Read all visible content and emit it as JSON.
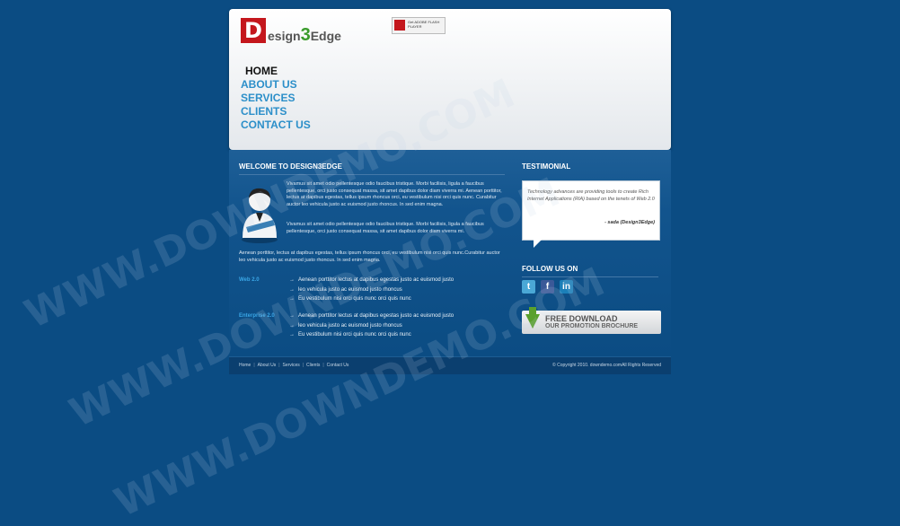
{
  "header": {
    "logo_mark": "D",
    "logo_word_a": "esign",
    "logo_num": "3",
    "logo_word_b": "Edge",
    "flash_badge": "Get ADOBE FLASH PLAYER"
  },
  "nav": [
    "HOME",
    "ABOUT US",
    "SERVICES",
    "CLIENTS",
    "CONTACT US"
  ],
  "main": {
    "heading": "WELCOME TO DESIGN3EDGE",
    "para1": "Vivamus sit amet odio pellentesque odio faucibus tristique. Morbi facilisis, ligula a faucibus pellentesque, orci justo consequat massa, sit amet dapibus dolor diam viverra mi. Aenean porttitor, lectus at dapibus egestas, tellus ipsum rhoncus orci, eu vestibulum nisi orci quis nunc. Curabitur auctor leo vehicula justo ac euismod justo rhoncus. In sed enim magna.",
    "para2": "Vivamus sit amet odio pellentesque odio faucibus tristique. Morbi facilisis, ligula a faucibus pellentesque, orci justo consequat massa, sit amet dapibus dolor diam viverra mi.",
    "para3": "Aenean porttitor, lectus at dapibus egestas, tellus ipsum rhoncus orci, eu vestibulum nisi orci quis nunc.Curabitur auctor leo vehicula justo ac euismod justo rhoncus. In sed enim magna.",
    "features": [
      {
        "label": "Web 2.0",
        "items": [
          "Aenean porttitor lectus at dapibus egestas justo ac euismod justo",
          "leo vehicula justo ac euismod justo rhoncus",
          "Eu vestibulum nisi orci quis nunc orci quis nunc"
        ]
      },
      {
        "label": "Enterprise 2.0",
        "items": [
          "Aenean porttitor lectus at dapibus egestas justo ac euismod justo",
          "leo vehicula justo ac euismod justo rhoncus",
          "Eu vestibulum nisi orci quis nunc orci quis nunc"
        ]
      }
    ]
  },
  "side": {
    "testimonial_heading": "TESTIMONIAL",
    "quote": "Technology advances are providing tools to create Rich Internet Applications (RIA) based on the tenets of Web 2.0",
    "author": "- sada (Design3Edge)",
    "follow_heading": "FOLLOW US ON",
    "social": [
      "t",
      "f",
      "in"
    ],
    "download_line1": "FREE DOWNLOAD",
    "download_line2": "OUR PROMOTION BROCHURE"
  },
  "footer": {
    "links": [
      "Home",
      "About Us",
      "Services",
      "Clients",
      "Contact Us"
    ],
    "copyright": "© Copyright 2010.",
    "site": "downdemo.com",
    "rights": "All Rights Reserved"
  },
  "watermark": "WWW.DOWNDEMO.COM",
  "colors": {
    "background": "#0b4c83",
    "link": "#2c8fc9",
    "accent": "#3aa6e6",
    "logo_red": "#c4171d"
  }
}
